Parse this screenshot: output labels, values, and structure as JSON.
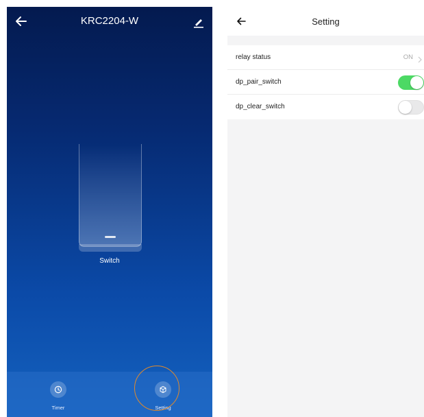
{
  "left_panel": {
    "title": "KRC2204-W",
    "switch_label": "Switch",
    "nav": [
      {
        "label": "Timer",
        "icon": "clock-icon"
      },
      {
        "label": "Setting",
        "icon": "settings-cube-icon"
      }
    ],
    "colors": {
      "gradient_top": "#041a4f",
      "gradient_bottom": "#1462bf",
      "highlight_ring": "#e08a2c"
    }
  },
  "right_panel": {
    "title": "Setting",
    "rows": [
      {
        "label": "relay status",
        "value": "ON"
      },
      {
        "label": "dp_pair_switch",
        "state": "on"
      },
      {
        "label": "dp_clear_switch",
        "state": "off"
      }
    ],
    "colors": {
      "toggle_on": "#4cd964",
      "background": "#f4f4f5"
    }
  }
}
